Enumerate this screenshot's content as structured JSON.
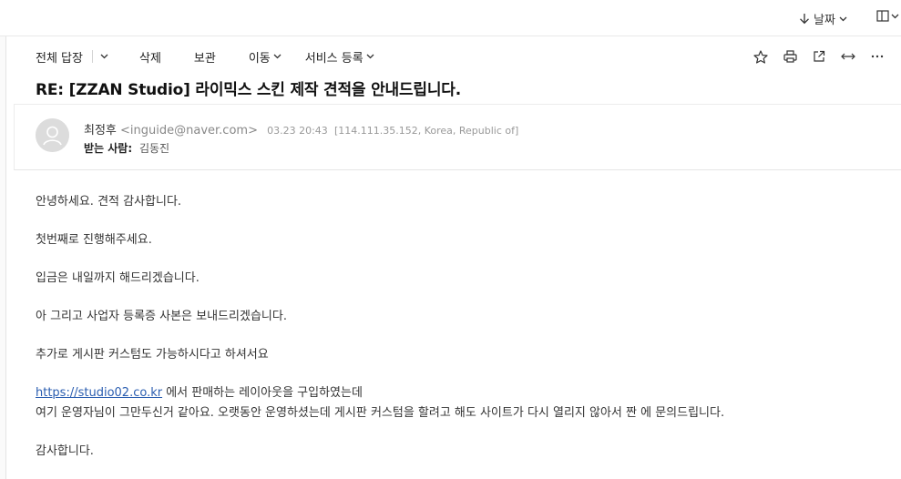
{
  "topbar": {
    "sort_label": "날짜",
    "sort_icon": "arrow-down-icon",
    "view_icon": "view-mode-icon"
  },
  "toolbar": {
    "reply_all": "전체 답장",
    "delete": "삭제",
    "archive": "보관",
    "move": "이동",
    "service_register": "서비스 등록",
    "icons": [
      "star-icon",
      "print-icon",
      "open-new-window-icon",
      "expand-icon",
      "more-icon"
    ]
  },
  "mail": {
    "subject": "RE: [ZZAN Studio] 라이믹스 스킨 제작 견적을 안내드립니다.",
    "from_name": "최정후",
    "from_address": "<inguide@naver.com>",
    "date": "03.23 20:43",
    "ip_info": "[114.111.35.152, Korea, Republic of]",
    "to_label": "받는 사람:",
    "to_name": "김동진"
  },
  "body": {
    "line1": "안녕하세요. 견적 감사합니다.",
    "line2": "첫번째로 진행해주세요.",
    "line3": "입금은 내일까지 해드리겠습니다.",
    "line4": "아 그리고 사업자 등록증 사본은 보내드리겠습니다.",
    "line5": "추가로 게시판 커스텀도 가능하시다고 하셔서요",
    "link": "https://studio02.co.kr",
    "line6_rest": " 에서 판매하는 레이아웃을 구입하였는데",
    "line7": "여기 운영자님이 그만두신거 같아요. 오랫동안 운영하셨는데 게시판 커스텀을 할려고 해도 사이트가 다시 열리지 않아서 짠 에 문의드립니다.",
    "line8": "감사합니다."
  },
  "colors": {
    "link": "#2a5db0",
    "avatar_bg": "#dedede"
  }
}
